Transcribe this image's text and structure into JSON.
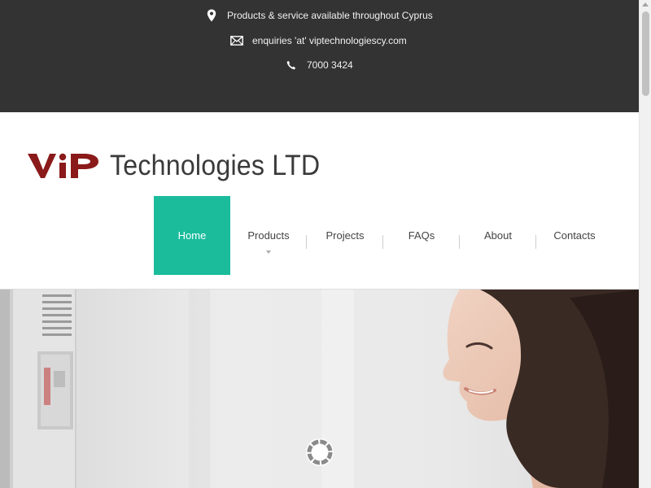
{
  "topbar": {
    "location": {
      "icon": "map-marker-icon",
      "text": "Products & service available throughout Cyprus"
    },
    "email": {
      "icon": "envelope-icon",
      "text": "enquiries 'at' viptechnologiescy.com"
    },
    "phone": {
      "icon": "phone-icon",
      "text": "7000 3424"
    }
  },
  "header": {
    "logo_mark": "ViP",
    "company_name": "Technologies LTD"
  },
  "nav": {
    "items": [
      {
        "label": "Home",
        "active": true
      },
      {
        "label": "Products",
        "has_dropdown": true
      },
      {
        "label": "Projects"
      },
      {
        "label": "FAQs"
      },
      {
        "label": "About"
      },
      {
        "label": "Contacts"
      }
    ]
  },
  "colors": {
    "topbar_bg": "#333333",
    "accent": "#1abc9c",
    "logo_red": "#8b1a1a"
  }
}
